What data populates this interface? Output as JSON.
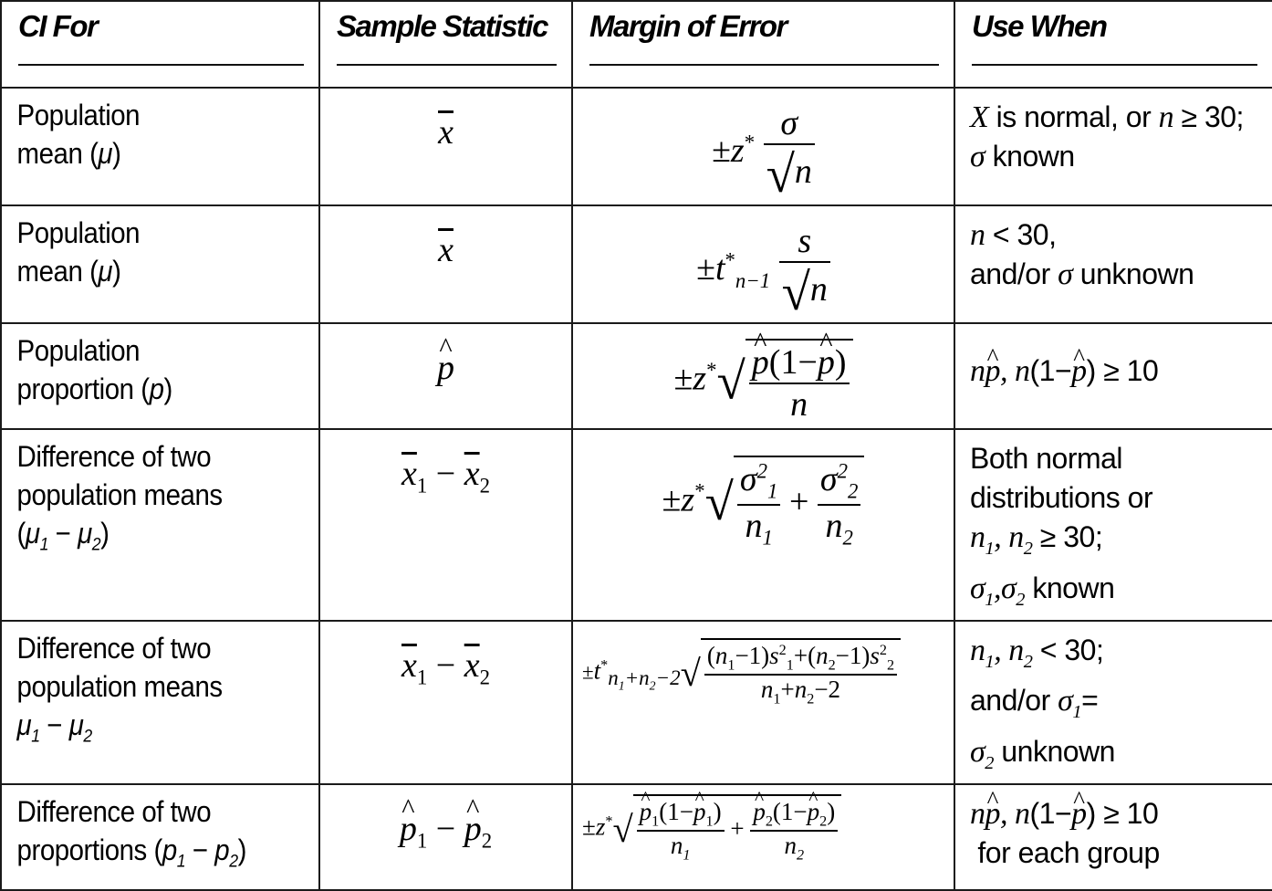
{
  "table": {
    "headers": [
      "CI For",
      "Sample Statistic",
      "Margin of Error",
      "Use When"
    ],
    "rows": [
      {
        "ci_for": [
          "Population",
          "mean (μ)"
        ],
        "sample_statistic": "x̄",
        "margin_of_error": "±z* σ/√n",
        "use_when": [
          "X is normal, or n ≥ 30;",
          "σ known"
        ]
      },
      {
        "ci_for": [
          "Population",
          "mean (μ)"
        ],
        "sample_statistic": "x̄",
        "margin_of_error": "±t*ₙ₋₁ s/√n",
        "use_when": [
          "n < 30,",
          "and/or σ unknown"
        ]
      },
      {
        "ci_for": [
          "Population",
          "proportion (p)"
        ],
        "sample_statistic": "p̂",
        "margin_of_error": "±z* √(p̂(1−p̂)/n)",
        "use_when": [
          "np̂, n(1−p̂) ≥ 10"
        ]
      },
      {
        "ci_for": [
          "Difference of two",
          "population means",
          "(μ1 − μ2)"
        ],
        "sample_statistic": "x̄1 − x̄2",
        "margin_of_error": "±z* √(σ1²/n1 + σ2²/n2)",
        "use_when": [
          "Both normal",
          "distributions or",
          "n1, n2 ≥ 30;",
          "σ1,σ2 known"
        ]
      },
      {
        "ci_for": [
          "Difference of two",
          "population means",
          "μ1 − μ2"
        ],
        "sample_statistic": "x̄1 − x̄2",
        "margin_of_error": "±t*(n1+n2−2) √(((n1−1)s1² + (n2−1)s2²)/(n1+n2−2))",
        "use_when": [
          "n1, n2 < 30;",
          "and/or σ1=",
          "σ2 unknown"
        ]
      },
      {
        "ci_for": [
          "Difference of two",
          "proportions (p1 − p2)"
        ],
        "sample_statistic": "p̂1 − p̂2",
        "margin_of_error": "±z* √(p̂1(1−p̂1)/n1 + p̂2(1−p̂2)/n2)",
        "use_when": [
          "np̂, n(1−p̂) ≥ 10",
          "for each group"
        ]
      }
    ]
  },
  "text": {
    "pop": "Population",
    "mean": "mean (",
    "prop": "proportion (",
    "diff": "Difference of two",
    "popmeans": "population means",
    "proportions": "proportions (",
    "known": " known",
    "unknown": " unknown",
    "isnormal": " is normal, or ",
    "ge30": " ≥ 30;",
    "lt30": " < 30,",
    "lt30s": " < 30;",
    "andor": "and/or ",
    "bothnormal": "Both normal",
    "distor": "distributions or",
    "foreach": "for each group",
    "ge10": " ≥ 10"
  }
}
